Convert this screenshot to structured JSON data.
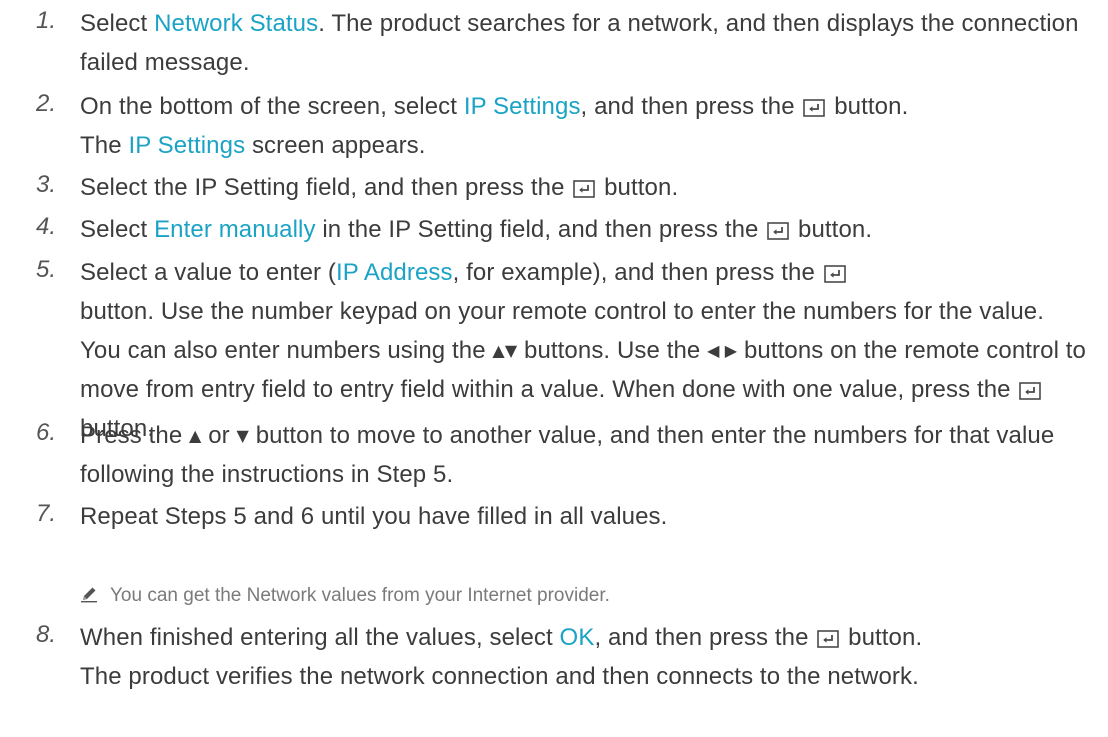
{
  "steps": [
    {
      "number": "1.",
      "parts": [
        "Select ",
        "Network Status",
        ". The product searches for a network, and then displays the connection failed message."
      ]
    },
    {
      "number": "2.",
      "parts": [
        "On the bottom of the screen, select ",
        "IP Settings",
        ", and then press the ",
        " button.",
        "The ",
        "IP Settings",
        " screen appears."
      ]
    },
    {
      "number": "3.",
      "parts": [
        "Select the IP Setting field, and then press the ",
        " button."
      ]
    },
    {
      "number": "4.",
      "parts": [
        "Select ",
        "Enter manually",
        " in the IP Setting field, and then press the ",
        " button."
      ]
    },
    {
      "number": "5.",
      "parts": [
        "Select a value to enter (",
        "IP Address",
        ", for example), and then press the ",
        "button. Use the number keypad on your remote control to enter the numbers for the value. You can also enter numbers using the ",
        " buttons. Use the ",
        "buttons on the remote control to move from entry field to entry field within a value. When done with one value, press the ",
        " button."
      ]
    },
    {
      "number": "6.",
      "parts": [
        "Press the ",
        " or ",
        " button to move to another value, and then enter the numbers for that value following the instructions in Step 5."
      ]
    },
    {
      "number": "7.",
      "parts": [
        "Repeat Steps 5 and 6 until you have filled in all values."
      ]
    },
    {
      "number": "8.",
      "parts": [
        "When finished entering all the values, select ",
        "OK",
        ", and then press the ",
        " button.",
        "The product verifies the network connection and then connects to the network."
      ]
    }
  ],
  "note": "You can get the Network values from your Internet provider.",
  "glyphs": {
    "up_down": "▲▼",
    "left_right": "◀ ▶",
    "up": "▲",
    "down": "▼"
  },
  "icons": {
    "enter": "enter-button-icon",
    "note": "pencil-icon"
  },
  "colors": {
    "text": "#3c3c3c",
    "highlight": "#1ba3c6",
    "note": "#7a7a7a"
  }
}
